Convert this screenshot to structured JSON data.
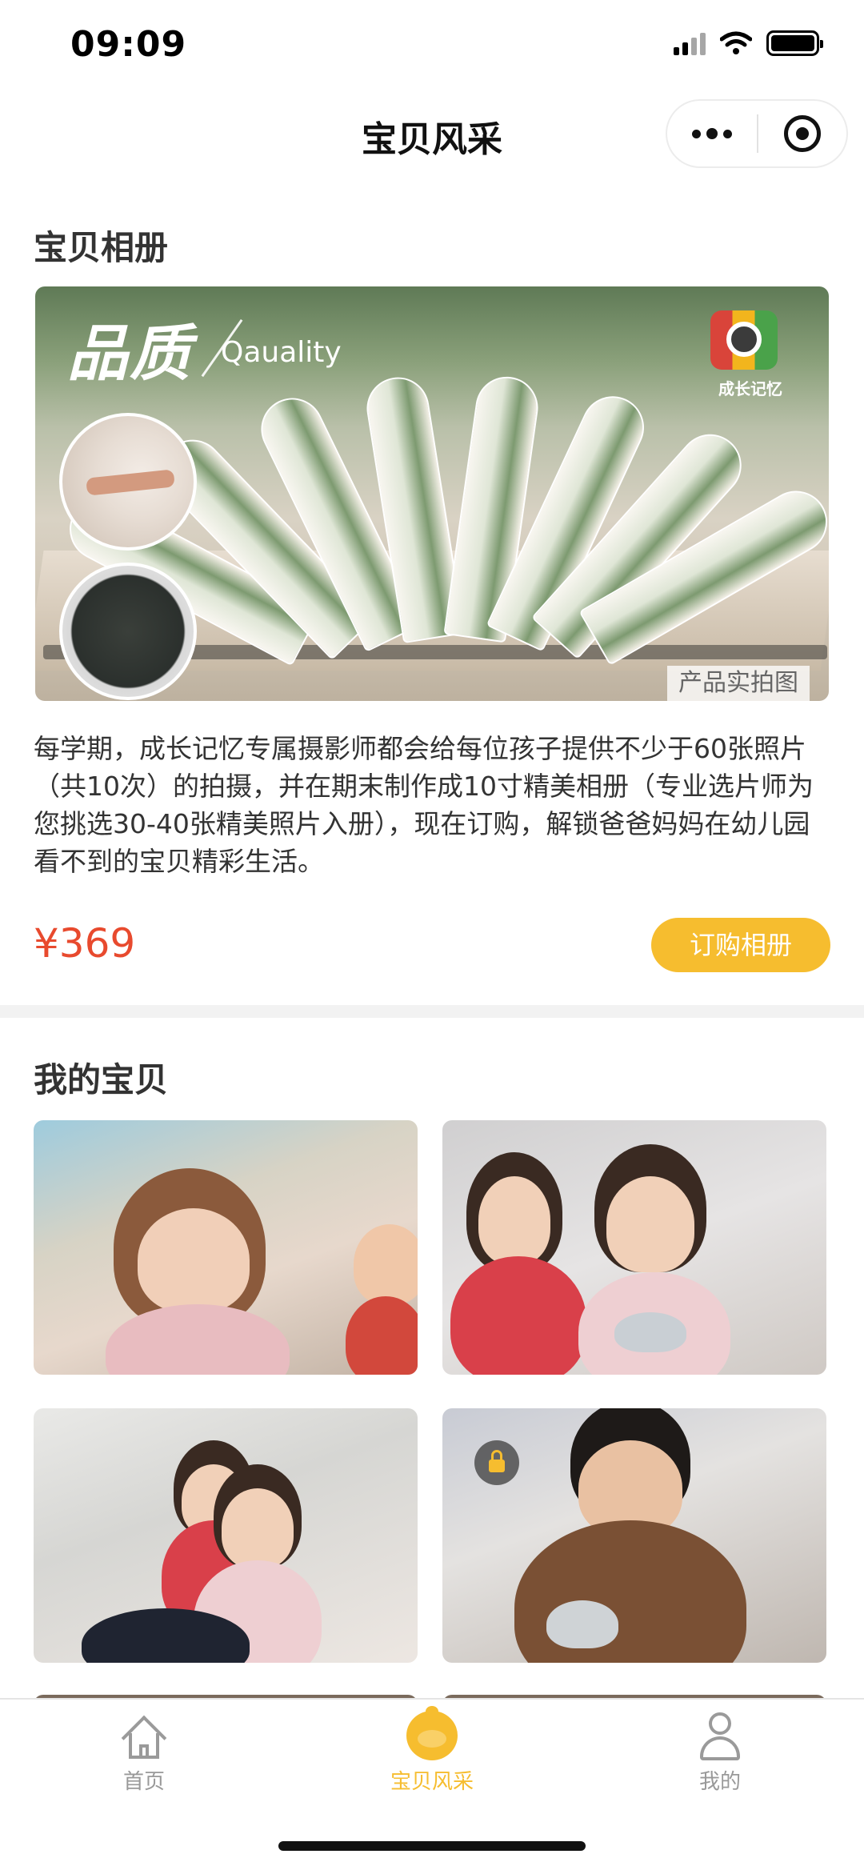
{
  "status_bar": {
    "time": "09:09"
  },
  "nav": {
    "title": "宝贝风采"
  },
  "album": {
    "section_title": "宝贝相册",
    "banner": {
      "headline_cn": "品质",
      "headline_en": "Qauality",
      "brand_text": "成长记忆",
      "tag": "产品实拍图"
    },
    "description": "每学期，成长记忆专属摄影师都会给每位孩子提供不少于60张照片（共10次）的拍摄，并在期末制作成10寸精美相册（专业选片师为您挑选30-40张精美照片入册），现在订购，解锁爸爸妈妈在幼儿园看不到的宝贝精彩生活。",
    "price": "¥369",
    "order_button": "订购相册"
  },
  "my_baby": {
    "section_title": "我的宝贝",
    "photos": [
      {
        "locked": false
      },
      {
        "locked": false
      },
      {
        "locked": false
      },
      {
        "locked": true
      }
    ]
  },
  "tab_bar": {
    "items": [
      {
        "label": "首页",
        "icon": "home-icon",
        "active": false
      },
      {
        "label": "宝贝风采",
        "icon": "baby-face-icon",
        "active": true
      },
      {
        "label": "我的",
        "icon": "user-icon",
        "active": false
      }
    ]
  },
  "colors": {
    "accent": "#f6bd2f",
    "price": "#e84a2e",
    "inactive_tab": "#999999"
  }
}
